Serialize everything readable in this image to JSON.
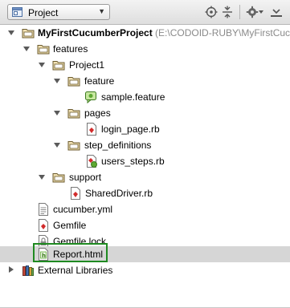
{
  "header": {
    "view_label": "Project"
  },
  "tree": {
    "root_name": "MyFirstCucumberProject",
    "root_path": "(E:\\CODOID-RUBY\\MyFirstCucu",
    "features": "features",
    "project1": "Project1",
    "feature": "feature",
    "sample_feature": "sample.feature",
    "pages": "pages",
    "login_page": "login_page.rb",
    "step_definitions": "step_definitions",
    "users_steps": "users_steps.rb",
    "support": "support",
    "shared_driver": "SharedDriver.rb",
    "cucumber_yml": "cucumber.yml",
    "gemfile": "Gemfile",
    "gemfile_lock": "Gemfile.lock",
    "report_html": "Report.html",
    "external_libraries": "External Libraries"
  },
  "colors": {
    "folder": "#d9b568",
    "highlight_box": "#1f8a21",
    "selected_row": "#d6d6d6"
  }
}
